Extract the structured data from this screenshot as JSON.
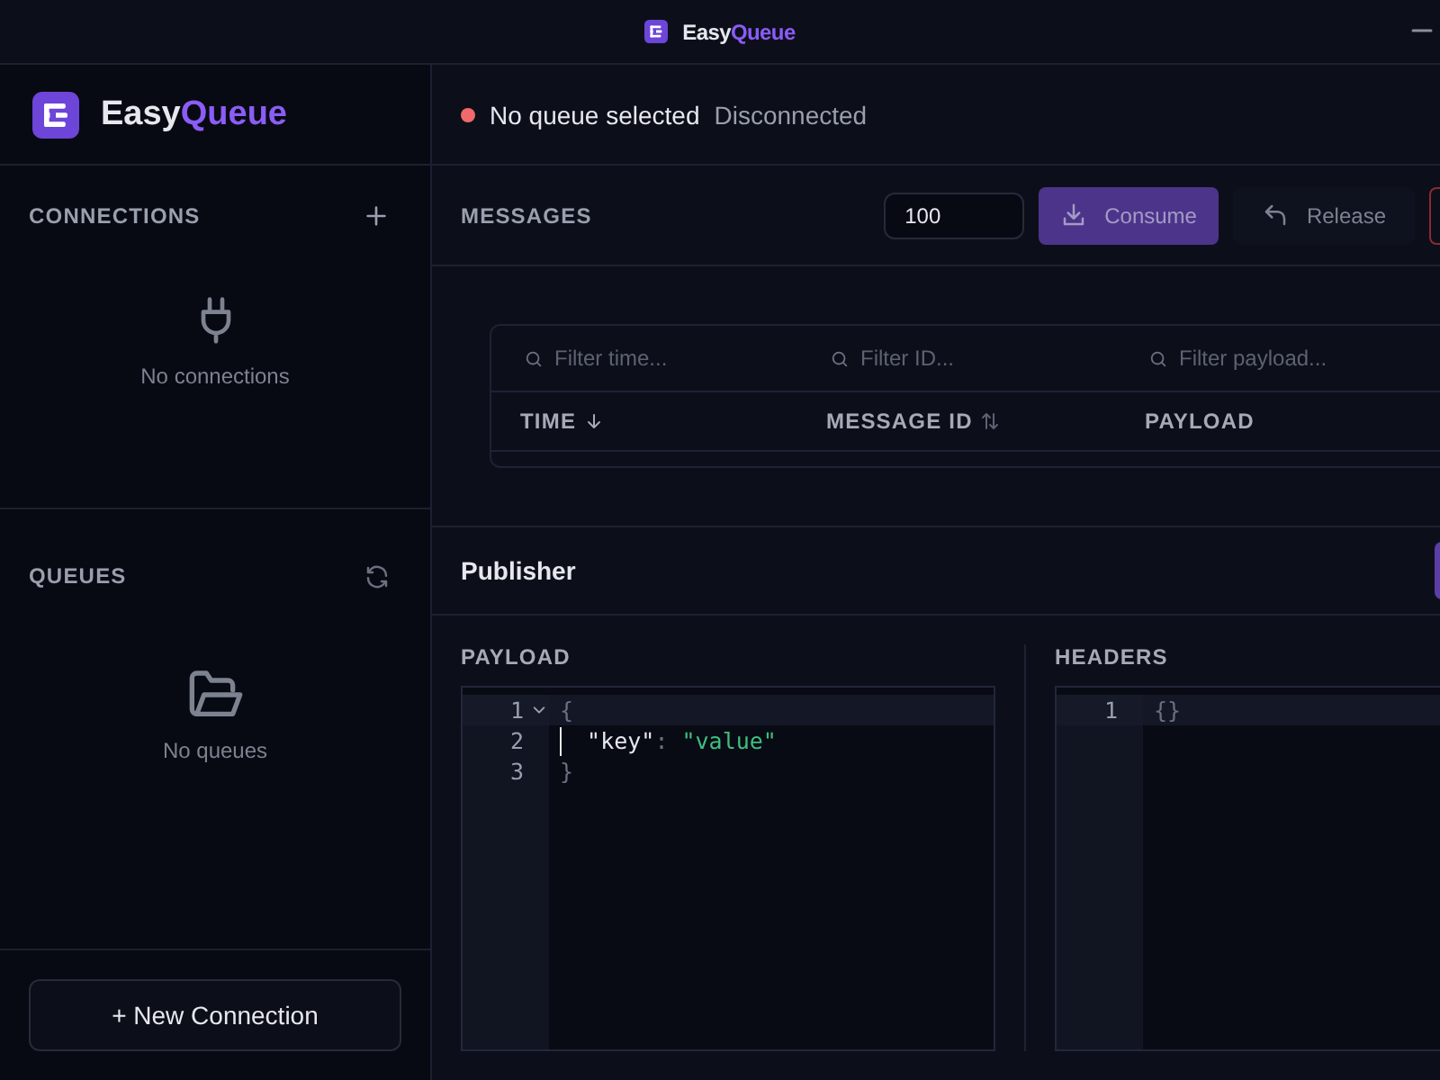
{
  "titlebar": {
    "name": "Easy",
    "accent": "Queue"
  },
  "sidebar": {
    "brand": {
      "name": "Easy",
      "accent": "Queue"
    },
    "sections": [
      {
        "kind": "connections",
        "title": "CONNECTIONS",
        "empty_text": "No connections"
      },
      {
        "kind": "queues",
        "title": "QUEUES",
        "empty_text": "No queues"
      }
    ],
    "new_connection_button": "+ New Connection"
  },
  "status": {
    "connected": false,
    "queue": "No queue selected",
    "connection_state": "Disconnected"
  },
  "messages": {
    "title": "MESSAGES",
    "count": "100",
    "buttons": [
      {
        "kind": "consume",
        "label": "Consume",
        "disabled": true
      },
      {
        "kind": "release",
        "label": "Release",
        "disabled": true
      },
      {
        "kind": "danger"
      }
    ],
    "columns": [
      {
        "filter_placeholder": "Filter time...",
        "heading": "TIME",
        "sorted": true
      },
      {
        "filter_placeholder": "Filter ID...",
        "heading": "MESSAGE ID",
        "sorted": false,
        "sortable": true
      },
      {
        "filter_placeholder": "Filter payload...",
        "heading": "PAYLOAD",
        "sorted": false,
        "sortable": false
      }
    ]
  },
  "publisher": {
    "title": "Publisher",
    "editors": [
      {
        "label": "PAYLOAD",
        "lines": [
          {
            "number": "1",
            "foldable": true,
            "highlighted": true,
            "cursor": false,
            "tokens": [
              {
                "kind": "punct",
                "text": "{"
              }
            ]
          },
          {
            "number": "2",
            "foldable": false,
            "highlighted": false,
            "cursor": true,
            "tokens": [
              {
                "kind": "key",
                "text": "  \"key\""
              },
              {
                "kind": "punct",
                "text": ": "
              },
              {
                "kind": "string",
                "text": "\"value\""
              }
            ]
          },
          {
            "number": "3",
            "foldable": false,
            "highlighted": false,
            "cursor": false,
            "tokens": [
              {
                "kind": "punct",
                "text": "}"
              }
            ]
          }
        ]
      },
      {
        "label": "HEADERS",
        "lines": [
          {
            "number": "1",
            "foldable": false,
            "highlighted": true,
            "cursor": false,
            "tokens": [
              {
                "kind": "punct",
                "text": "{}"
              }
            ]
          }
        ]
      }
    ]
  }
}
